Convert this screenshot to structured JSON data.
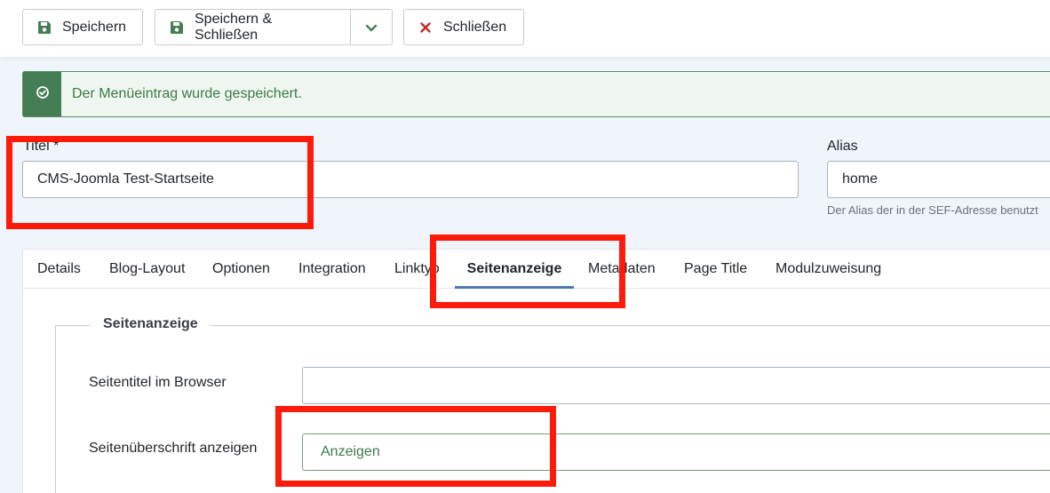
{
  "toolbar": {
    "save_label": "Speichern",
    "save_close_label": "Speichern & Schließen",
    "close_label": "Schließen"
  },
  "alert": {
    "message": "Der Menüeintrag wurde gespeichert."
  },
  "form": {
    "title_label": "Titel *",
    "title_value": "CMS-Joomla Test-Startseite",
    "alias_label": "Alias",
    "alias_value": "home",
    "alias_hint": "Der Alias der in der SEF-Adresse benutzt"
  },
  "tabs": [
    {
      "label": "Details"
    },
    {
      "label": "Blog-Layout"
    },
    {
      "label": "Optionen"
    },
    {
      "label": "Integration"
    },
    {
      "label": "Linktyp"
    },
    {
      "label": "Seitenanzeige",
      "active": true
    },
    {
      "label": "Metadaten"
    },
    {
      "label": "Page Title"
    },
    {
      "label": "Modulzuweisung"
    }
  ],
  "page_display": {
    "legend": "Seitenanzeige",
    "browser_title_label": "Seitentitel im Browser",
    "browser_title_value": "",
    "show_heading_label": "Seitenüberschrift anzeigen",
    "show_heading_value": "Anzeigen"
  },
  "colors": {
    "accent_green": "#457d54",
    "tab_underline": "#5174b8",
    "highlight_red": "#ff1a0a"
  }
}
